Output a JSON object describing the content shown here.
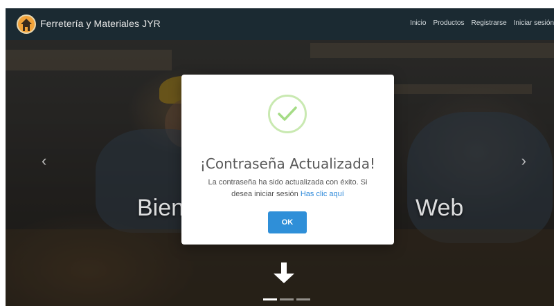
{
  "navbar": {
    "brand": "Ferretería y Materiales JYR",
    "links": [
      "Inicio",
      "Productos",
      "Registrarse",
      "Iniciar sesión"
    ]
  },
  "hero": {
    "title_left": "Bien",
    "title_right": "Web",
    "prev_icon": "‹",
    "next_icon": "›",
    "indicators": 3,
    "active_indicator": 1
  },
  "modal": {
    "icon": "check-icon",
    "title": "¡Contraseña Actualizada!",
    "text": "La contraseña ha sido actualizada con éxito. Si desea iniciar sesión",
    "link": "Has clic aquí",
    "button": "OK",
    "colors": {
      "accent": "#2f8fd8",
      "success": "#a5dc86",
      "link": "#2c88d9"
    }
  }
}
